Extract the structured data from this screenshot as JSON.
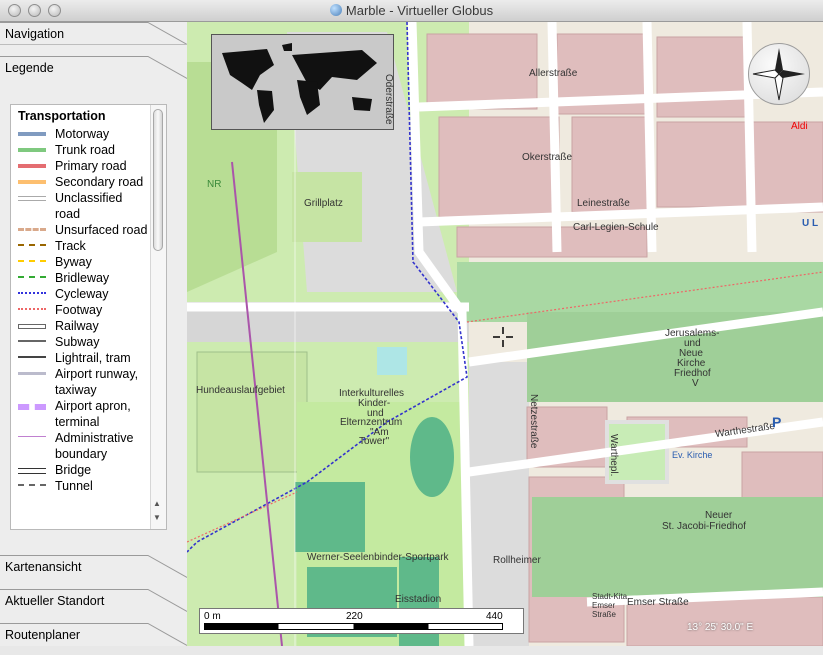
{
  "window": {
    "title": "Marble - Virtueller Globus"
  },
  "sidebar": {
    "sections_top": [
      {
        "label": "Navigation"
      },
      {
        "label": "Legende"
      }
    ],
    "sections_bottom": [
      {
        "label": "Kartenansicht"
      },
      {
        "label": "Aktueller Standort"
      },
      {
        "label": "Routenplaner"
      }
    ]
  },
  "legend": {
    "heading": "Transportation",
    "items": [
      {
        "label": "Motorway",
        "color": "#809bc0"
      },
      {
        "label": "Trunk road",
        "color": "#7fc97f"
      },
      {
        "label": "Primary road",
        "color": "#e46d71"
      },
      {
        "label": "Secondary road",
        "color": "#fdbf6f"
      },
      {
        "label": "Unclassified road",
        "color": "#cccccc"
      },
      {
        "label": "Unsurfaced road",
        "color": "#d9a98b"
      },
      {
        "label": "Track",
        "color": "#996600"
      },
      {
        "label": "Byway",
        "color": "#ffcc00"
      },
      {
        "label": "Bridleway",
        "color": "#33aa33"
      },
      {
        "label": "Cycleway",
        "color": "#3333dd"
      },
      {
        "label": "Footway",
        "color": "#ee6666"
      },
      {
        "label": "Railway",
        "color": "#888888"
      },
      {
        "label": "Subway",
        "color": "#666666"
      },
      {
        "label": "Lightrail, tram",
        "color": "#444444"
      },
      {
        "label": "Airport runway, taxiway",
        "color": "#bbbbcc"
      },
      {
        "label": "Airport apron, terminal",
        "color": "#cc99ff"
      },
      {
        "label": "Administrative boundary",
        "color": "#c080d0"
      },
      {
        "label": "Bridge",
        "color": "#333333"
      },
      {
        "label": "Tunnel",
        "color": "#666666"
      }
    ]
  },
  "map": {
    "labels": [
      {
        "text": "Allerstraße"
      },
      {
        "text": "Okerstraße"
      },
      {
        "text": "Leinestraße"
      },
      {
        "text": "Carl-Legien-Schule"
      },
      {
        "text": "Grillplatz"
      },
      {
        "text": "Hundeauslaufgebiet"
      },
      {
        "text": "Interkulturelles"
      },
      {
        "text": "Kinder-"
      },
      {
        "text": "und"
      },
      {
        "text": "Elternzentrum"
      },
      {
        "text": "\"Am"
      },
      {
        "text": "Tower\""
      },
      {
        "text": "Jerusalems-"
      },
      {
        "text": "und"
      },
      {
        "text": "Neue"
      },
      {
        "text": "Kirche"
      },
      {
        "text": "Friedhof"
      },
      {
        "text": "V"
      },
      {
        "text": "Neuer"
      },
      {
        "text": "St. Jacobi-Friedhof"
      },
      {
        "text": "Warthestraße"
      },
      {
        "text": "Rollheimer"
      },
      {
        "text": "Werner-Seelenbinder-Sportpark"
      },
      {
        "text": "Eisstadion"
      },
      {
        "text": "Oderstraße"
      },
      {
        "text": "Netzestraße"
      },
      {
        "text": "Warthepl."
      },
      {
        "text": "Emser Straße"
      },
      {
        "text": "Aldi"
      },
      {
        "text": "NR"
      },
      {
        "text": "U L"
      },
      {
        "text": "P"
      },
      {
        "text": "Stadt-Kita Emser Straße"
      },
      {
        "text": "Ev. Kirche"
      }
    ],
    "scale": {
      "ticks": [
        "0 m",
        "220",
        "440"
      ]
    },
    "coordinate": "13° 25' 30.0\" E"
  }
}
